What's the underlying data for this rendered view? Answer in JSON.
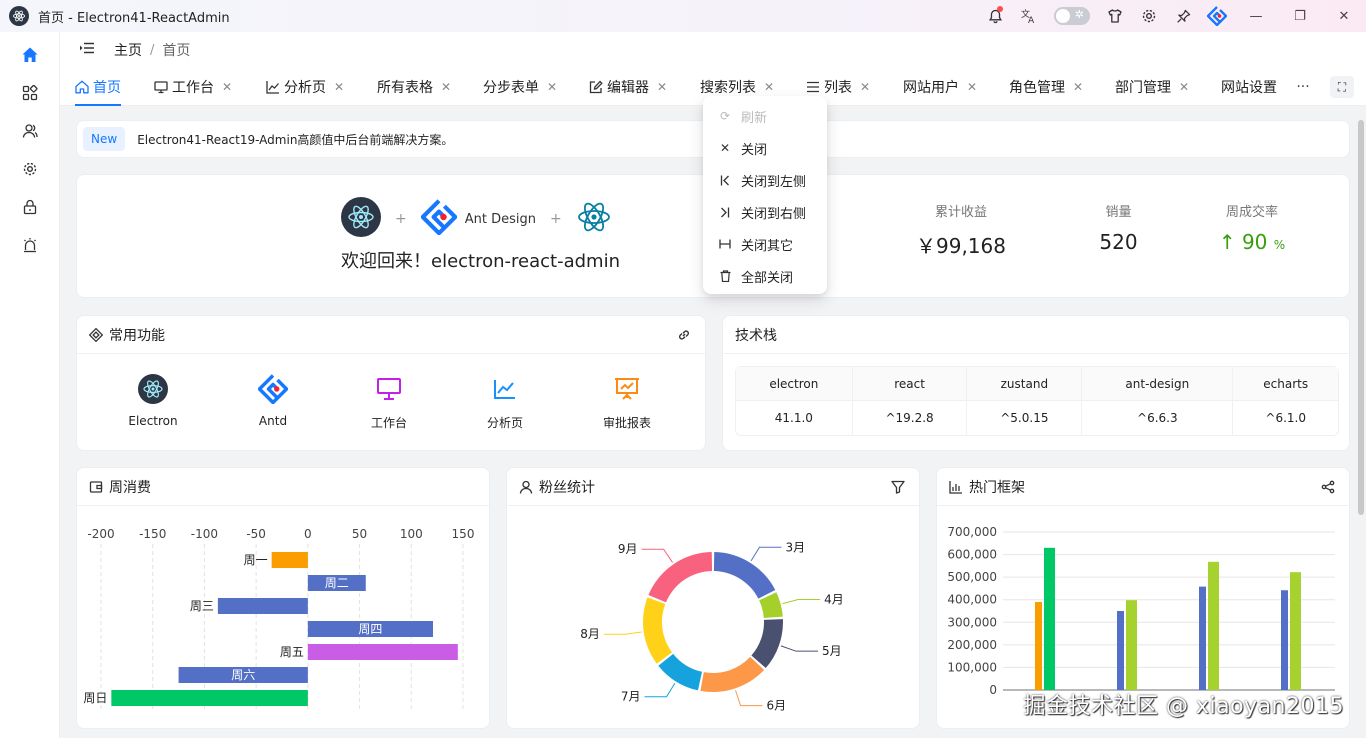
{
  "window": {
    "title": "首页 - Electron41-ReactAdmin",
    "icons": [
      "bell-icon",
      "translate-icon",
      "theme-toggle",
      "shirt-icon",
      "gear-icon",
      "pin-icon",
      "antd-logo",
      "minimize",
      "maximize",
      "close"
    ]
  },
  "header": {
    "breadcrumb_root": "主页",
    "breadcrumb_sep": "/",
    "breadcrumb_current": "首页"
  },
  "tabs": [
    {
      "label": "首页",
      "icon": "home-icon",
      "active": true
    },
    {
      "label": "工作台",
      "icon": "desktop-icon"
    },
    {
      "label": "分析页",
      "icon": "line-chart-icon"
    },
    {
      "label": "所有表格"
    },
    {
      "label": "分步表单"
    },
    {
      "label": "编辑器",
      "icon": "edit-icon"
    },
    {
      "label": "搜索列表"
    },
    {
      "label": "列表",
      "icon": "list-icon"
    },
    {
      "label": "网站用户"
    },
    {
      "label": "角色管理"
    },
    {
      "label": "部门管理"
    },
    {
      "label": "网站设置"
    }
  ],
  "tabs_more": "···",
  "notice": {
    "tag": "New",
    "text": "Electron41-React19-Admin高颜值中后台前端解决方案。"
  },
  "welcome": {
    "ant_design": "Ant Design",
    "plus": "+",
    "greeting": "欢迎回来！electron-react-admin"
  },
  "stats": [
    {
      "label": "累计收益",
      "value": "￥99,168"
    },
    {
      "label": "销量",
      "value": "520"
    },
    {
      "label": "周成交率",
      "value": "↑ 90",
      "unit": "%",
      "color": "#389e0d"
    }
  ],
  "common": {
    "title": "常用功能",
    "items": [
      {
        "label": "Electron",
        "icon": "electron-icon"
      },
      {
        "label": "Antd",
        "icon": "antd-icon"
      },
      {
        "label": "工作台",
        "icon": "monitor-icon",
        "color": "#c41fe6"
      },
      {
        "label": "分析页",
        "icon": "line-chart-icon",
        "color": "#1890ff"
      },
      {
        "label": "审批报表",
        "icon": "presentation-icon",
        "color": "#fa8c16"
      }
    ]
  },
  "tech": {
    "title": "技术栈",
    "headers": [
      "electron",
      "react",
      "zustand",
      "ant-design",
      "echarts"
    ],
    "values": [
      "41.1.0",
      "^19.2.8",
      "^5.0.15",
      "^6.6.3",
      "^6.1.0"
    ]
  },
  "context_menu": [
    {
      "label": "刷新",
      "icon": "reload-icon",
      "disabled": true
    },
    {
      "label": "关闭",
      "icon": "close-icon"
    },
    {
      "label": "关闭到左侧",
      "icon": "close-left-icon"
    },
    {
      "label": "关闭到右侧",
      "icon": "close-right-icon"
    },
    {
      "label": "关闭其它",
      "icon": "close-others-icon"
    },
    {
      "label": "全部关闭",
      "icon": "delete-icon"
    }
  ],
  "chart_titles": {
    "weekly": "周消费",
    "fans": "粉丝统计",
    "hot": "热门框架"
  },
  "watermark": "掘金技术社区 @ xiaoyan2015",
  "chart_data": [
    {
      "type": "bar",
      "orientation": "horizontal",
      "title": "周消费",
      "x_ticks": [
        "-200",
        "-150",
        "-100",
        "-50",
        "0",
        "50",
        "100",
        "150"
      ],
      "xlim": [
        -200,
        150
      ],
      "categories": [
        "周一",
        "周二",
        "周三",
        "周四",
        "周五",
        "周六",
        "周日"
      ],
      "values": [
        -35,
        56,
        -87,
        121,
        145,
        -125,
        -190
      ],
      "colors": [
        "#fa9d00",
        "#5470c6",
        "#5470c6",
        "#5470c6",
        "#c95de6",
        "#5470c6",
        "#00c866"
      ],
      "label_inside": [
        false,
        true,
        false,
        true,
        false,
        true,
        false
      ]
    },
    {
      "type": "pie",
      "title": "粉丝统计",
      "donut": true,
      "labels": [
        "3月",
        "4月",
        "5月",
        "6月",
        "7月",
        "8月",
        "9月"
      ],
      "values": [
        14,
        5,
        10,
        13,
        9,
        13,
        15
      ],
      "colors": [
        "#5470c6",
        "#a5cf2a",
        "#4a5170",
        "#fd9848",
        "#16a3dd",
        "#ffd118",
        "#f9627f"
      ]
    },
    {
      "type": "bar",
      "title": "热门框架",
      "y_ticks": [
        "0",
        "100,000",
        "200,000",
        "300,000",
        "400,000",
        "500,000",
        "600,000",
        "700,000"
      ],
      "ylim": [
        0,
        700000
      ],
      "groups": [
        {
          "bars": [
            {
              "value": 390000,
              "color": "#fa9d00"
            },
            {
              "value": 630000,
              "color": "#00c866"
            }
          ]
        },
        {
          "bars": [
            {
              "value": 350000,
              "color": "#5470c6"
            },
            {
              "value": 398000,
              "color": "#a5d22e"
            }
          ]
        },
        {
          "bars": [
            {
              "value": 458000,
              "color": "#5470c6"
            },
            {
              "value": 568000,
              "color": "#a5d22e"
            }
          ]
        },
        {
          "bars": [
            {
              "value": 442000,
              "color": "#5470c6"
            },
            {
              "value": 522000,
              "color": "#a5d22e"
            }
          ]
        }
      ]
    }
  ],
  "colors": {
    "primary": "#1677ff",
    "green": "#389e0d"
  }
}
